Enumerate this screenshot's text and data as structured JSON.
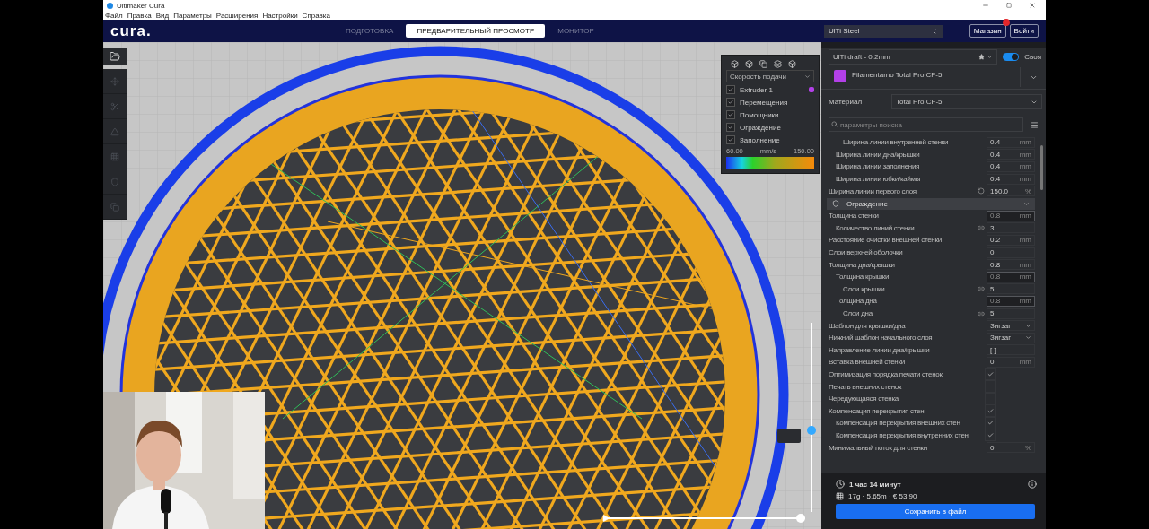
{
  "window": {
    "title": "Ultimaker Cura"
  },
  "menu": [
    "Файл",
    "Правка",
    "Вид",
    "Параметры",
    "Расширения",
    "Настройки",
    "Справка"
  ],
  "header": {
    "logo": "cura.",
    "tabs": [
      {
        "label": "ПОДГОТОВКА",
        "selected": false
      },
      {
        "label": "ПРЕДВАРИТЕЛЬНЫЙ ПРОСМОТР",
        "selected": true
      },
      {
        "label": "МОНИТОР",
        "selected": false
      }
    ],
    "printer": "UlTi Steel",
    "buttons": [
      {
        "label": "Магазин",
        "badge": true
      },
      {
        "label": "Войти",
        "badge": false
      }
    ]
  },
  "legend": {
    "color_scheme": "Скорость подачи",
    "layers": [
      {
        "label": "Extruder 1",
        "checked": true,
        "color": "#b340e8"
      },
      {
        "label": "Перемещения",
        "checked": true
      },
      {
        "label": "Помощники",
        "checked": true
      },
      {
        "label": "Ограждение",
        "checked": true
      },
      {
        "label": "Заполнение",
        "checked": true
      }
    ],
    "min": "60.00",
    "unit": "mm/s",
    "max": "150.00"
  },
  "layer_slider": {
    "level": 0.43
  },
  "path_slider": {
    "level": 1
  },
  "settings": {
    "profile": "UlTi draft - 0.2mm",
    "custom": {
      "label": "Своя",
      "on": true
    },
    "extruder": "Filamentarno Total Pro CF-5",
    "material_label": "Материал",
    "material": "Total Pro CF-5",
    "search_placeholder": "параметры поиска",
    "rows_before": [
      {
        "children": [
          {
            "label": "Ширина линии внутренней стенки",
            "kind": "field",
            "value": "0.4",
            "unit": "mm",
            "disabled": false
          }
        ]
      },
      {
        "label": "Ширина линии дна/крышки",
        "kind": "field",
        "value": "0.4",
        "unit": "mm",
        "disabled": false
      },
      {
        "label": "Ширина линии заполнения",
        "kind": "field",
        "value": "0.4",
        "unit": "mm",
        "disabled": false
      },
      {
        "label": "Ширина линии юбки/каймы",
        "kind": "field",
        "value": "0.4",
        "unit": "mm",
        "disabled": false
      }
    ],
    "rows_top": [
      {
        "label": "Ширина линии первого слоя",
        "kind": "field",
        "value": "150.0",
        "unit": "%",
        "disabled": false,
        "reset": true
      }
    ],
    "section": "Ограждение",
    "rows": [
      {
        "label": "Толщина стенки",
        "kind": "field",
        "value": "0.8",
        "unit": "mm",
        "disabled": true,
        "children": [
          {
            "label": "Количество линий стенки",
            "kind": "field",
            "value": "3",
            "disabled": false,
            "linked": true
          }
        ]
      },
      {
        "label": "Расстояние очистки внешней стенки",
        "kind": "field",
        "value": "0.2",
        "unit": "mm",
        "disabled": false
      },
      {
        "label": "Слои верхней оболочки",
        "kind": "field",
        "value": "0",
        "disabled": false
      },
      {
        "label": "Толщина дна/крышки",
        "kind": "field",
        "value": "0.8",
        "unit": "mm",
        "disabled": false,
        "children": [
          {
            "label": "Толщина крышки",
            "kind": "field",
            "value": "0.8",
            "unit": "mm",
            "disabled": true,
            "children": [
              {
                "label": "Слои крышки",
                "kind": "field",
                "value": "5",
                "disabled": false,
                "linked": true
              }
            ]
          },
          {
            "label": "Толщина дна",
            "kind": "field",
            "value": "0.8",
            "unit": "mm",
            "disabled": true,
            "children": [
              {
                "label": "Слои дна",
                "kind": "field",
                "value": "5",
                "disabled": false,
                "linked": true
              }
            ]
          }
        ]
      },
      {
        "label": "Шаблон для крышки/дна",
        "kind": "dropdown",
        "value": "Зигзаг"
      },
      {
        "label": "Нижний шаблон начального слоя",
        "kind": "dropdown",
        "value": "Зигзаг"
      },
      {
        "label": "Направление линии дна/крышки",
        "kind": "field",
        "value": "[ ]",
        "disabled": false
      },
      {
        "label": "Вставка внешней стенки",
        "kind": "field",
        "value": "0",
        "unit": "mm",
        "disabled": false
      },
      {
        "label": "Оптимизация порядка печати стенок",
        "kind": "checkbox",
        "checked": true
      },
      {
        "label": "Печать внешних стенок",
        "kind": "checkbox",
        "checked": false
      },
      {
        "label": "Чередующаяся стенка",
        "kind": "checkbox",
        "checked": false
      },
      {
        "label": "Компенсация перекрытия стен",
        "kind": "checkbox",
        "checked": true,
        "children": [
          {
            "label": "Компенсация перекрытия внешних стен",
            "kind": "checkbox",
            "checked": true
          },
          {
            "label": "Компенсация перекрытия внутренних стен",
            "kind": "checkbox",
            "checked": true
          }
        ]
      },
      {
        "label": "Минимальный поток для стенки",
        "kind": "field",
        "value": "0",
        "unit": "%",
        "disabled": false
      }
    ]
  },
  "summary": {
    "time": "1 час 14 минут",
    "material": "17g · 5.65m · € 53.90",
    "save": "Сохранить в файл"
  }
}
